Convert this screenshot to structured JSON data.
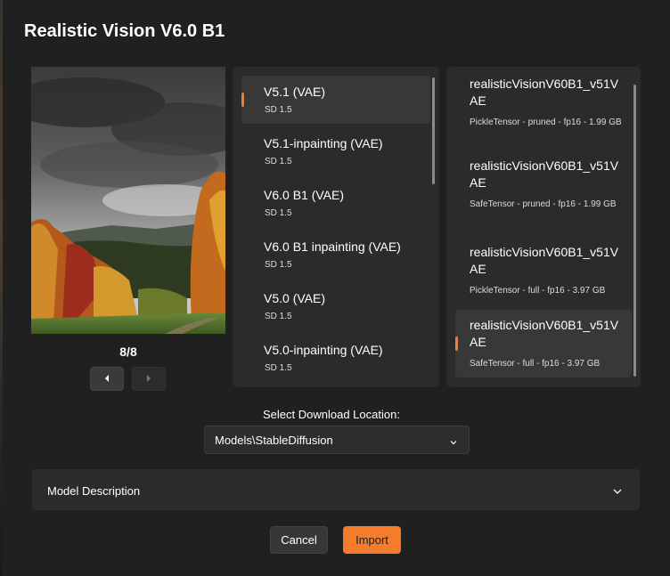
{
  "dialog": {
    "title": "Realistic Vision V6.0 B1"
  },
  "preview": {
    "counter": "8/8",
    "prev_icon": "caret-left-icon",
    "next_icon": "caret-right-icon"
  },
  "versions": [
    {
      "name": "V5.1 (VAE)",
      "base": "SD 1.5",
      "selected": true
    },
    {
      "name": "V5.1-inpainting (VAE)",
      "base": "SD 1.5",
      "selected": false
    },
    {
      "name": "V6.0 B1 (VAE)",
      "base": "SD 1.5",
      "selected": false
    },
    {
      "name": "V6.0 B1 inpainting (VAE)",
      "base": "SD 1.5",
      "selected": false
    },
    {
      "name": "V5.0 (VAE)",
      "base": "SD 1.5",
      "selected": false
    },
    {
      "name": "V5.0-inpainting (VAE)",
      "base": "SD 1.5",
      "selected": false
    }
  ],
  "files": [
    {
      "name": "realisticVisionV60B1_v51VAE",
      "meta": "PickleTensor - pruned - fp16 - 1.99 GB",
      "selected": false
    },
    {
      "name": "realisticVisionV60B1_v51VAE",
      "meta": "SafeTensor - pruned - fp16 - 1.99 GB",
      "selected": false
    },
    {
      "name": "realisticVisionV60B1_v51VAE",
      "meta": "PickleTensor - full - fp16 - 3.97 GB",
      "selected": false
    },
    {
      "name": "realisticVisionV60B1_v51VAE",
      "meta": "SafeTensor - full - fp16 - 3.97 GB",
      "selected": true
    }
  ],
  "download": {
    "label": "Select Download Location:",
    "value": "Models\\StableDiffusion"
  },
  "description": {
    "label": "Model Description"
  },
  "buttons": {
    "cancel": "Cancel",
    "import": "Import"
  },
  "colors": {
    "accent": "#f57c2a",
    "background": "#202020",
    "panel": "#2b2b2b",
    "selected": "#383838"
  }
}
